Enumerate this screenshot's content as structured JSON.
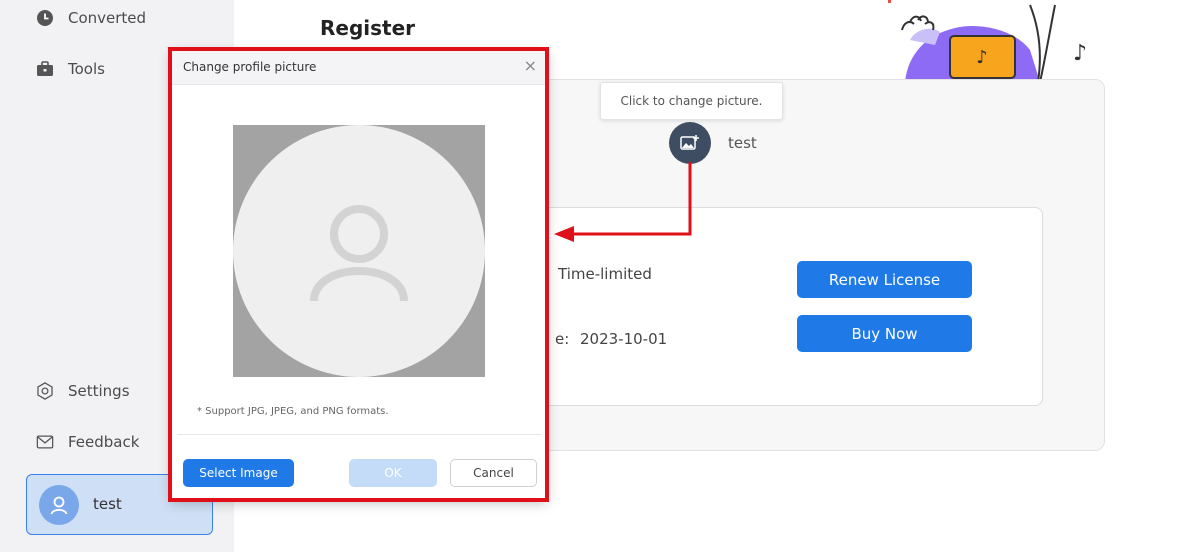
{
  "sidebar": {
    "items": [
      {
        "label": "Converted",
        "icon": "clock-icon"
      },
      {
        "label": "Tools",
        "icon": "toolbox-icon"
      },
      {
        "label": "Settings",
        "icon": "settings-icon"
      },
      {
        "label": "Feedback",
        "icon": "mail-icon"
      }
    ],
    "user": {
      "name": "test"
    }
  },
  "main": {
    "title": "Register",
    "tooltip": "Click to change picture.",
    "profile_name": "test",
    "license": {
      "type": "Time-limited",
      "date_label_fragment": "e:",
      "date": "2023-10-01"
    },
    "buttons": {
      "renew": "Renew License",
      "buy": "Buy Now"
    }
  },
  "dialog": {
    "title": "Change profile picture",
    "close": "×",
    "note": "* Support JPG, JPEG, and PNG formats.",
    "buttons": {
      "select": "Select Image",
      "ok": "OK",
      "cancel": "Cancel"
    }
  },
  "colors": {
    "accent": "#1f7ae8",
    "highlight": "#e0101a",
    "sidebar_bg": "#f2f2f4"
  }
}
